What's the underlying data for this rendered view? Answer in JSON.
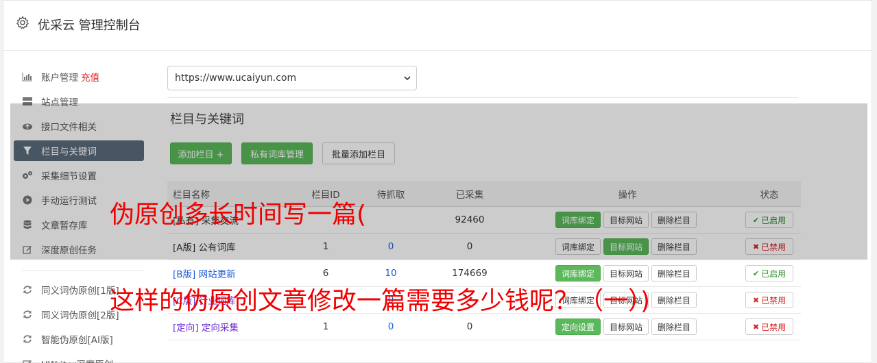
{
  "header": {
    "title": "优采云 管理控制台"
  },
  "sidebar": {
    "items": [
      {
        "label": "账户管理",
        "extra": "充值",
        "icon": "bar-chart-icon"
      },
      {
        "label": "站点管理",
        "icon": "server-icon"
      },
      {
        "label": "接口文件相关",
        "icon": "cloud-upload-icon"
      },
      {
        "label": "栏目与关键词",
        "icon": "filter-icon",
        "active": true
      },
      {
        "label": "采集细节设置",
        "icon": "cogs-icon"
      },
      {
        "label": "手动运行测试",
        "icon": "play-circle-icon"
      },
      {
        "label": "文章暂存库",
        "icon": "database-icon"
      },
      {
        "label": "深度原创任务",
        "icon": "edit-icon"
      }
    ],
    "items2": [
      {
        "label": "同义词伪原创[1版]",
        "icon": "refresh-icon"
      },
      {
        "label": "同义词伪原创[2版]",
        "icon": "refresh-icon"
      },
      {
        "label": "智能伪原创[AI版]",
        "icon": "refresh-icon"
      },
      {
        "label": "UWriter深度原创",
        "icon": "edit-icon"
      }
    ]
  },
  "site_select": {
    "value": "https://www.ucaiyun.com"
  },
  "section": {
    "title": "栏目与关键词"
  },
  "toolbar": {
    "add": "添加栏目 +",
    "private": "私有词库管理",
    "batch": "批量添加栏目"
  },
  "table": {
    "headers": {
      "name": "栏目名称",
      "id": "栏目ID",
      "wait": "待抓取",
      "done": "已采集",
      "op": "操作",
      "status": "状态"
    },
    "rows": [
      {
        "name": "[私有] 采集交流",
        "id": "",
        "wait": "",
        "done": "92460",
        "op1": "词库绑定",
        "op2": "目标网站",
        "op3": "删除栏目",
        "status": "已启用"
      },
      {
        "name": "[A版] 公有词库",
        "id": "1",
        "wait": "0",
        "done": "0",
        "op1": "词库绑定",
        "op2": "目标网站",
        "op3": "删除栏目",
        "status": "已禁用"
      },
      {
        "name": "[B版] 网站更新",
        "id": "6",
        "wait": "10",
        "done": "174669",
        "op1": "词库绑定",
        "op2": "目标网站",
        "op3": "删除栏目",
        "status": "已启用"
      },
      {
        "name": "[C版] 行业词库",
        "id": "",
        "wait": "0",
        "done": "",
        "op1": "词库绑定",
        "op2": "目标网站",
        "op3": "删除栏目",
        "status": "已禁用"
      },
      {
        "name": "[定向] 定向采集",
        "id": "1",
        "wait": "0",
        "done": "0",
        "op1": "定向设置",
        "op2": "目标网站",
        "op3": "删除栏目",
        "status": "已禁用"
      }
    ]
  },
  "overlay_text": {
    "line1": "伪原创多长时间写一篇(",
    "line2": "这样的伪原创文章修改一篇需要多少钱呢？（一）)"
  }
}
